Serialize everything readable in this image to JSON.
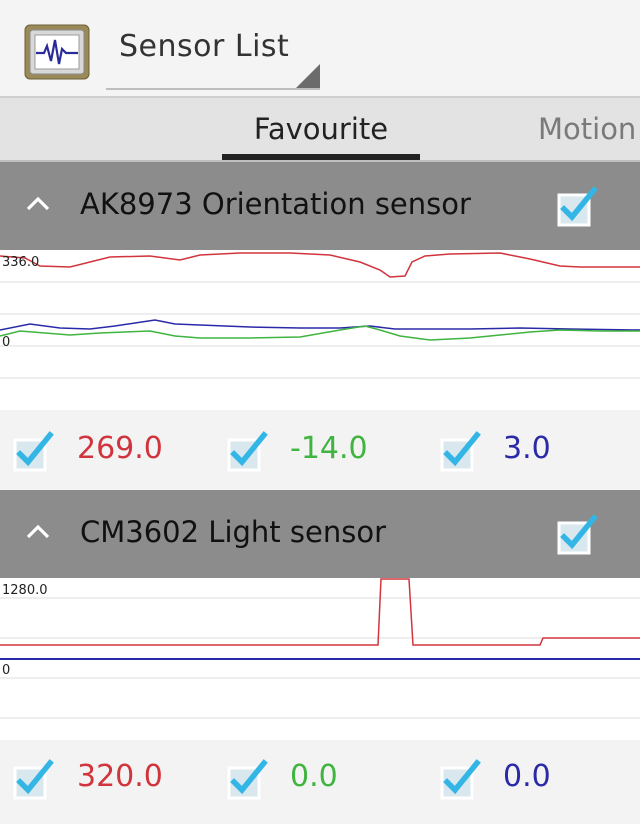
{
  "app": {
    "title": "Sensor List",
    "icon": "waveform-chip-icon"
  },
  "tabs": [
    {
      "label": "Favourite",
      "selected": true
    },
    {
      "label": "Motion",
      "selected": false
    }
  ],
  "colors": {
    "channel_x": "#d0353d",
    "channel_y": "#3fb43f",
    "channel_z": "#2a2aa8",
    "checkbox_blue": "#33b5e5",
    "header_bg": "#8c8c8c"
  },
  "sensors": [
    {
      "name": "AK8973 Orientation sensor",
      "enabled": true,
      "y_max_label": "336.0",
      "y_min_label": "0",
      "values": [
        {
          "checked": true,
          "value": "269.0",
          "color": "#d0353d"
        },
        {
          "checked": true,
          "value": "-14.0",
          "color": "#3fb43f"
        },
        {
          "checked": true,
          "value": "3.0",
          "color": "#2a2aa8"
        }
      ]
    },
    {
      "name": "CM3602 Light sensor",
      "enabled": true,
      "y_max_label": "1280.0",
      "y_min_label": "0",
      "values": [
        {
          "checked": true,
          "value": "320.0",
          "color": "#d0353d"
        },
        {
          "checked": true,
          "value": "0.0",
          "color": "#3fb43f"
        },
        {
          "checked": true,
          "value": "0.0",
          "color": "#2a2aa8"
        }
      ]
    }
  ]
}
